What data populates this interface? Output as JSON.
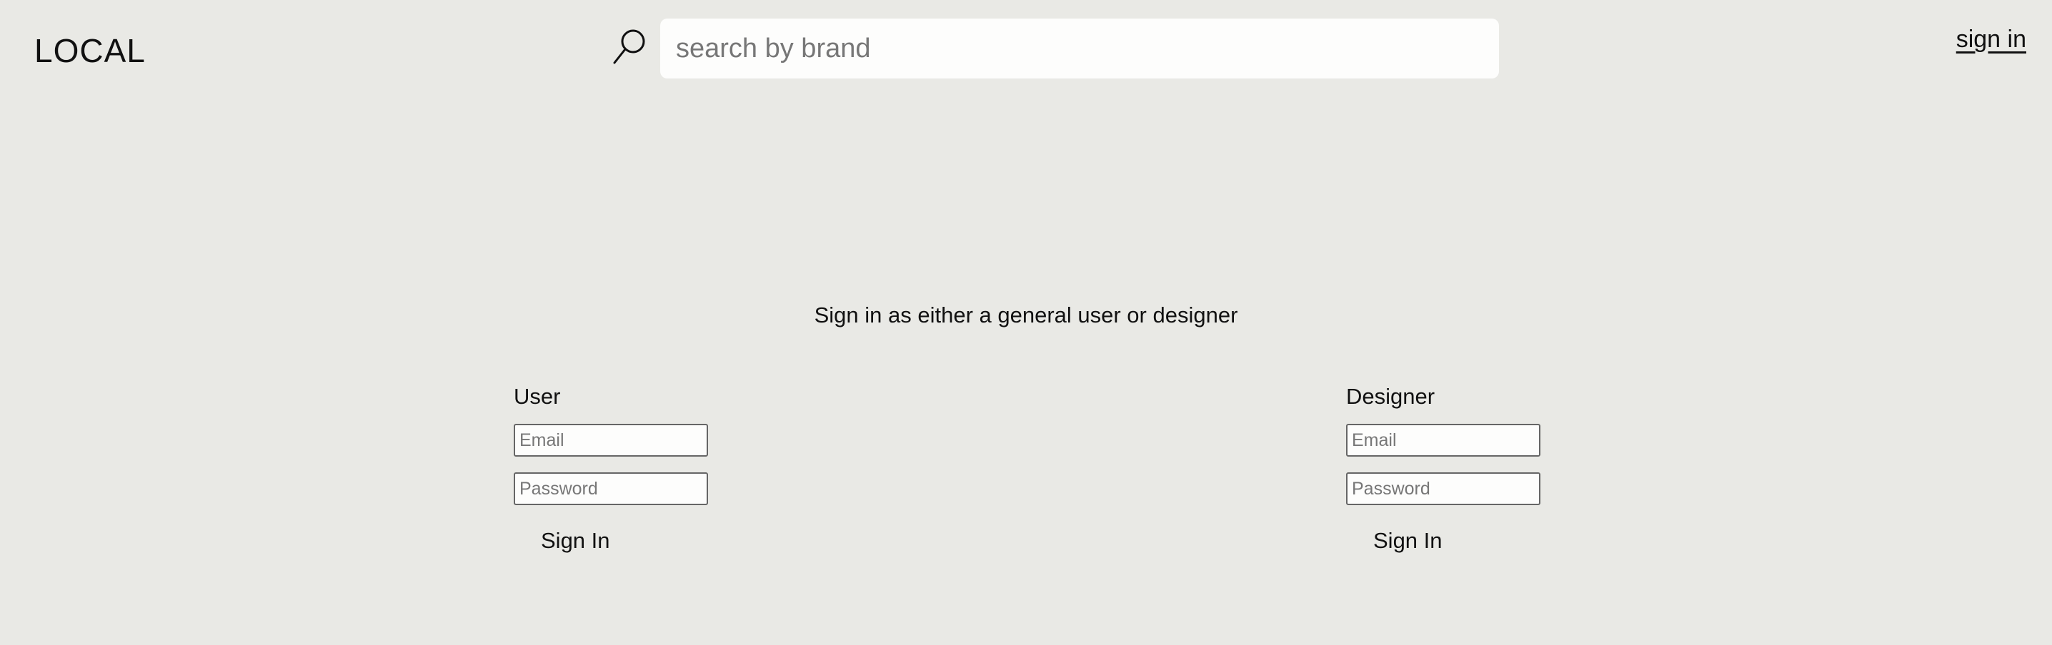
{
  "header": {
    "logo": "LOCAL",
    "search": {
      "icon": "search-icon",
      "value": "",
      "placeholder": "search by brand"
    },
    "sign_in_link": "sign in"
  },
  "main": {
    "subtitle": "Sign in as either a general user or designer",
    "user_form": {
      "heading": "User",
      "email_placeholder": "Email",
      "password_placeholder": "Password",
      "submit_label": "Sign In"
    },
    "designer_form": {
      "heading": "Designer",
      "email_placeholder": "Email",
      "password_placeholder": "Password",
      "submit_label": "Sign In"
    }
  },
  "colors": {
    "background": "#e9e9e5",
    "search_background": "#fdfdfc",
    "text": "#111111"
  }
}
